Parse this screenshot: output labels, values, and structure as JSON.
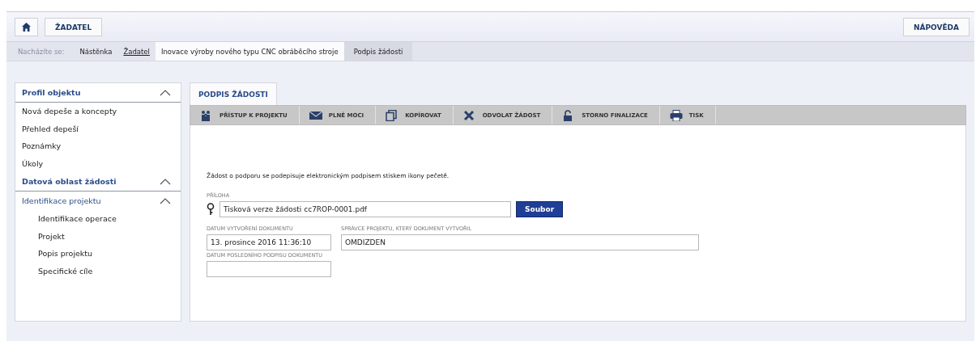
{
  "header": {
    "user_button": "ŽADATEL",
    "help_button": "NÁPOVĚDA"
  },
  "breadcrumb": {
    "label": "Nacházíte se:",
    "items": [
      {
        "text": "Nástěnka",
        "kind": "plain"
      },
      {
        "text": "Žadatel",
        "kind": "link"
      },
      {
        "text": "Inovace výroby nového typu CNC obráběcího stroje",
        "kind": "highlight"
      },
      {
        "text": "Podpis žádosti",
        "kind": "last"
      }
    ]
  },
  "sidebar": {
    "sections": [
      {
        "title": "Profil objektu",
        "expanded": true,
        "children": [
          {
            "label": "Nová depeše a koncepty"
          },
          {
            "label": "Přehled depeší"
          },
          {
            "label": "Poznámky"
          },
          {
            "label": "Úkoly"
          }
        ]
      },
      {
        "title": "Datová oblast žádosti",
        "expanded": true,
        "children": [
          {
            "label": "Identifikace projektu",
            "expanded": true,
            "children": [
              {
                "label": "Identifikace operace"
              },
              {
                "label": "Projekt"
              },
              {
                "label": "Popis projektu"
              },
              {
                "label": "Specifické cíle"
              }
            ]
          }
        ]
      }
    ]
  },
  "tabs": [
    {
      "label": "PODPIS ŽÁDOSTI",
      "selected": true
    }
  ],
  "toolbar": [
    {
      "label": "PŘÍSTUP K PROJEKTU",
      "kind": "people"
    },
    {
      "label": "PLNÉ MOCI",
      "kind": "mail"
    },
    {
      "label": "KOPÍROVAT",
      "kind": "copy"
    },
    {
      "label": "ODVOLAT ŽÁDOST",
      "kind": "cross"
    },
    {
      "label": "STORNO FINALIZACE",
      "kind": "lock"
    },
    {
      "label": "TISK",
      "kind": "print"
    }
  ],
  "form": {
    "note": "Žádost o podporu se podepisuje elektronickým podpisem stiskem ikony pečetě.",
    "attachment": {
      "label": "PŘÍLOHA",
      "value": "Tisková verze žádosti cc7ROP-0001.pdf",
      "button": "Soubor"
    },
    "fields": [
      {
        "label": "DATUM VYTVOŘENÍ DOKUMENTU",
        "value": "13. prosince 2016 11:36:10",
        "kind": "short"
      },
      {
        "label": "SPRÁVCE PROJEKTU, KTERÝ DOKUMENT VYTVOŘIL",
        "value": "OMDIZDEN",
        "kind": "long"
      },
      {
        "label": "DATUM POSLEDNÍHO PODPISU DOKUMENTU",
        "kind": "short"
      }
    ]
  }
}
